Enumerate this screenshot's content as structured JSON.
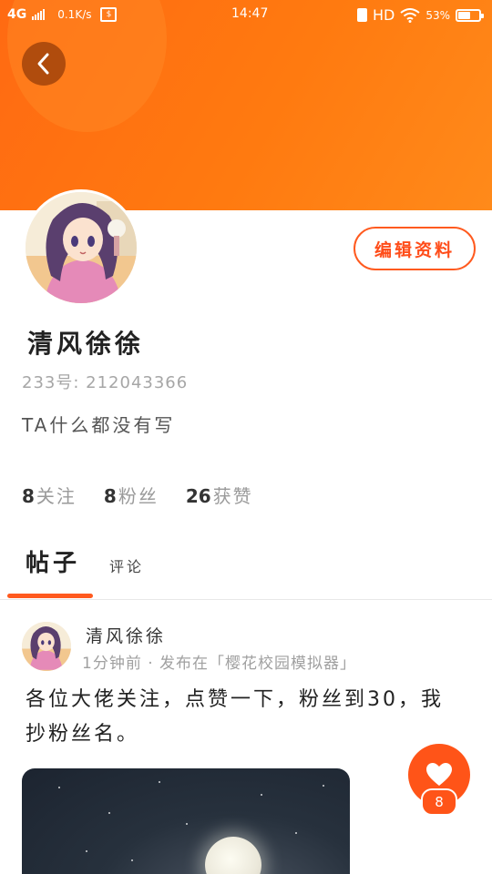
{
  "status_bar": {
    "network": "4G",
    "speed": "0.1K/s",
    "time": "14:47",
    "hd": "HD",
    "battery": "53%",
    "battery_level": 0.53
  },
  "profile": {
    "name": "清风徐徐",
    "id_line": "233号: 212043366",
    "bio": "TA什么都没有写",
    "edit_button": "编辑资料"
  },
  "stats": {
    "following_count": "8",
    "following_label": "关注",
    "fans_count": "8",
    "fans_label": "粉丝",
    "likes_count": "26",
    "likes_label": "获赞"
  },
  "tabs": [
    {
      "label": "帖子",
      "active": true
    },
    {
      "label": "评论",
      "active": false
    }
  ],
  "post": {
    "author": "清风徐徐",
    "meta": "1分钟前 · 发布在「樱花校园模拟器」",
    "text": "各位大佬关注，点赞一下，粉丝到30，我抄粉丝名。",
    "like_count": "8"
  },
  "icons": {
    "back": "back-arrow-icon",
    "like": "heart-icon",
    "wifi": "wifi-icon"
  },
  "colors": {
    "accent": "#ff5a1f",
    "banner": "#ff7a10"
  }
}
